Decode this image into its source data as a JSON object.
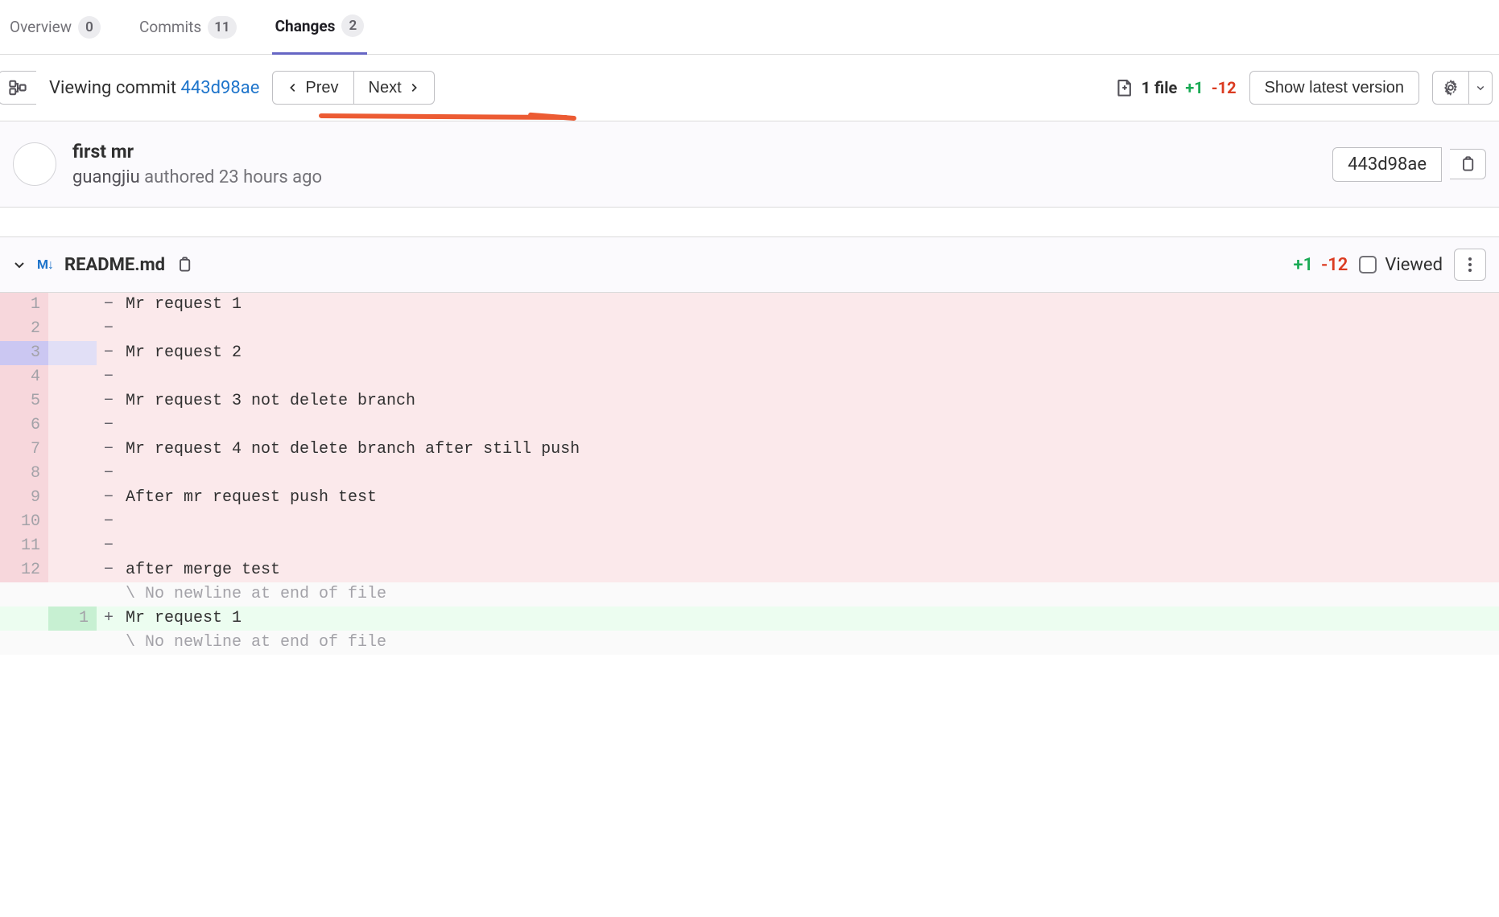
{
  "tabs": {
    "overview": {
      "label": "Overview",
      "count": "0"
    },
    "commits": {
      "label": "Commits",
      "count": "11"
    },
    "changes": {
      "label": "Changes",
      "count": "2"
    }
  },
  "action": {
    "viewing_prefix": "Viewing commit ",
    "sha": "443d98ae",
    "prev": "Prev",
    "next": "Next",
    "file_count_label": "1 file",
    "plus": "+1",
    "minus": "-12",
    "latest": "Show latest version"
  },
  "commit": {
    "title": "first mr",
    "author": "guangjiu",
    "authored_word": "authored",
    "time": "23 hours ago",
    "sha_short": "443d98ae"
  },
  "file": {
    "name": "README.md",
    "plus": "+1",
    "minus": "-12",
    "viewed_label": "Viewed"
  },
  "diff": {
    "lines": [
      {
        "type": "del",
        "old": "1",
        "new": "",
        "text": "Mr request 1"
      },
      {
        "type": "del",
        "old": "2",
        "new": "",
        "text": ""
      },
      {
        "type": "del",
        "old": "3",
        "new": "",
        "text": "Mr request 2",
        "selected": true
      },
      {
        "type": "del",
        "old": "4",
        "new": "",
        "text": ""
      },
      {
        "type": "del",
        "old": "5",
        "new": "",
        "text": "Mr request 3 not delete branch"
      },
      {
        "type": "del",
        "old": "6",
        "new": "",
        "text": ""
      },
      {
        "type": "del",
        "old": "7",
        "new": "",
        "text": "Mr request 4 not delete branch after still push"
      },
      {
        "type": "del",
        "old": "8",
        "new": "",
        "text": ""
      },
      {
        "type": "del",
        "old": "9",
        "new": "",
        "text": "After mr request push test"
      },
      {
        "type": "del",
        "old": "10",
        "new": "",
        "text": ""
      },
      {
        "type": "del",
        "old": "11",
        "new": "",
        "text": ""
      },
      {
        "type": "del",
        "old": "12",
        "new": "",
        "text": "after merge test"
      },
      {
        "type": "meta",
        "old": "",
        "new": "",
        "text": "\\ No newline at end of file"
      },
      {
        "type": "add",
        "old": "",
        "new": "1",
        "text": "Mr request 1"
      },
      {
        "type": "meta",
        "old": "",
        "new": "",
        "text": "\\ No newline at end of file"
      }
    ]
  }
}
